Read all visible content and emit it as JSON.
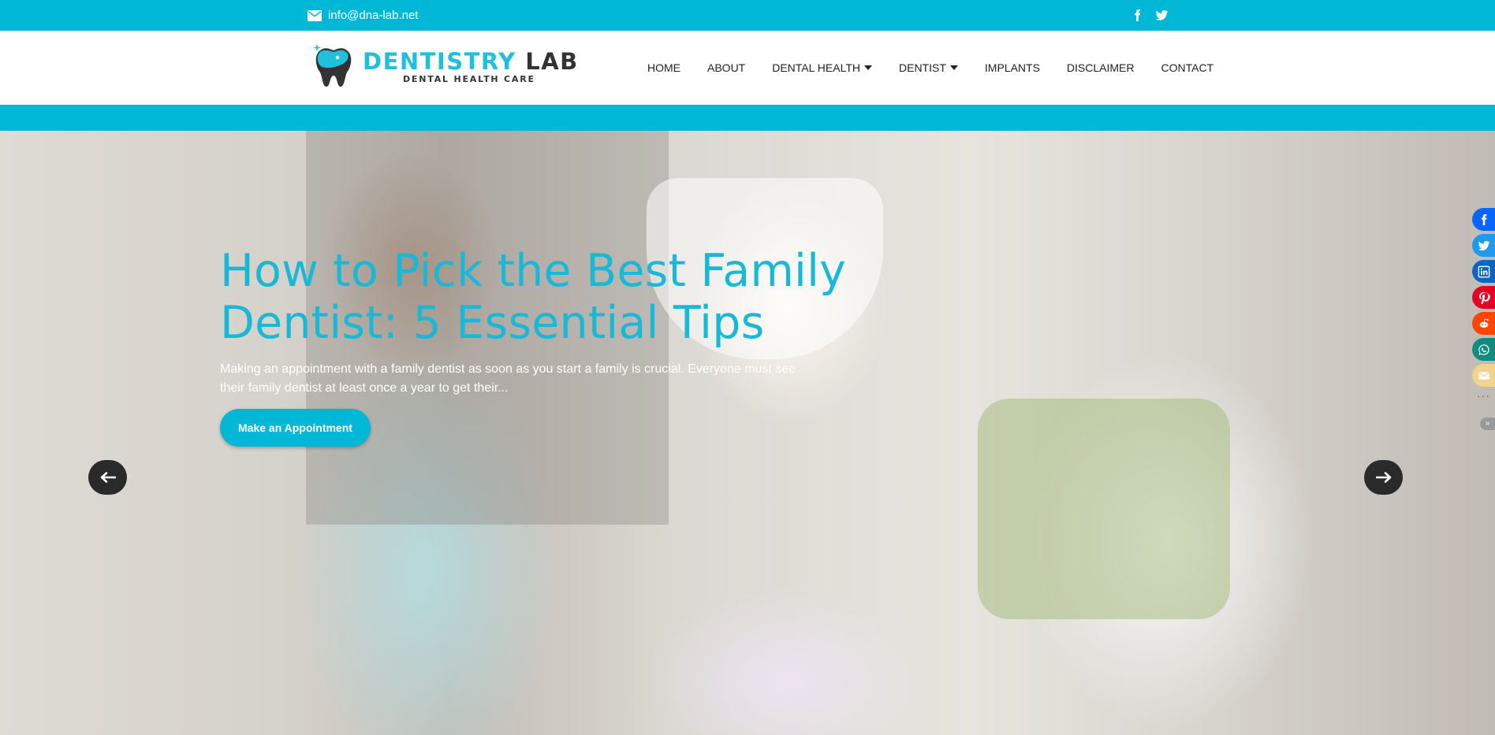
{
  "topbar": {
    "email": "info@dna-lab.net",
    "email_icon": "envelope-icon",
    "social": [
      {
        "name": "facebook-icon"
      },
      {
        "name": "twitter-icon"
      }
    ]
  },
  "logo": {
    "title_part1": "DENTISTRY",
    "title_part2": " LAB",
    "subtitle": "DENTAL HEALTH CARE",
    "icon": "tooth-icon"
  },
  "nav": {
    "items": [
      {
        "label": "HOME",
        "dropdown": false
      },
      {
        "label": "ABOUT",
        "dropdown": false
      },
      {
        "label": "DENTAL HEALTH",
        "dropdown": true
      },
      {
        "label": "DENTIST",
        "dropdown": true
      },
      {
        "label": "IMPLANTS",
        "dropdown": false
      },
      {
        "label": "DISCLAIMER",
        "dropdown": false
      },
      {
        "label": "CONTACT",
        "dropdown": false
      }
    ]
  },
  "hero": {
    "title": "How to Pick the Best Family Dentist: 5 Essential Tips",
    "text": "Making an appointment with a family dentist as soon as you start a family is crucial. Everyone must see their family dentist at least once a year to get their...",
    "button_label": "Make an Appointment",
    "prev_icon": "arrow-left-icon",
    "next_icon": "arrow-right-icon"
  },
  "share": {
    "buttons": [
      {
        "name": "facebook-share-icon",
        "color": "#0866ff"
      },
      {
        "name": "twitter-share-icon",
        "color": "#1d9bf0"
      },
      {
        "name": "linkedin-share-icon",
        "color": "#0a66c2"
      },
      {
        "name": "pinterest-share-icon",
        "color": "#e60023"
      },
      {
        "name": "reddit-share-icon",
        "color": "#ff4500"
      },
      {
        "name": "whatsapp-share-icon",
        "color": "#128c7e"
      },
      {
        "name": "email-share-icon",
        "color": "#f1d38e"
      }
    ],
    "more": "···",
    "collapse": "»"
  },
  "colors": {
    "accent": "#00b8d6",
    "hero_title": "#17b9d6"
  }
}
